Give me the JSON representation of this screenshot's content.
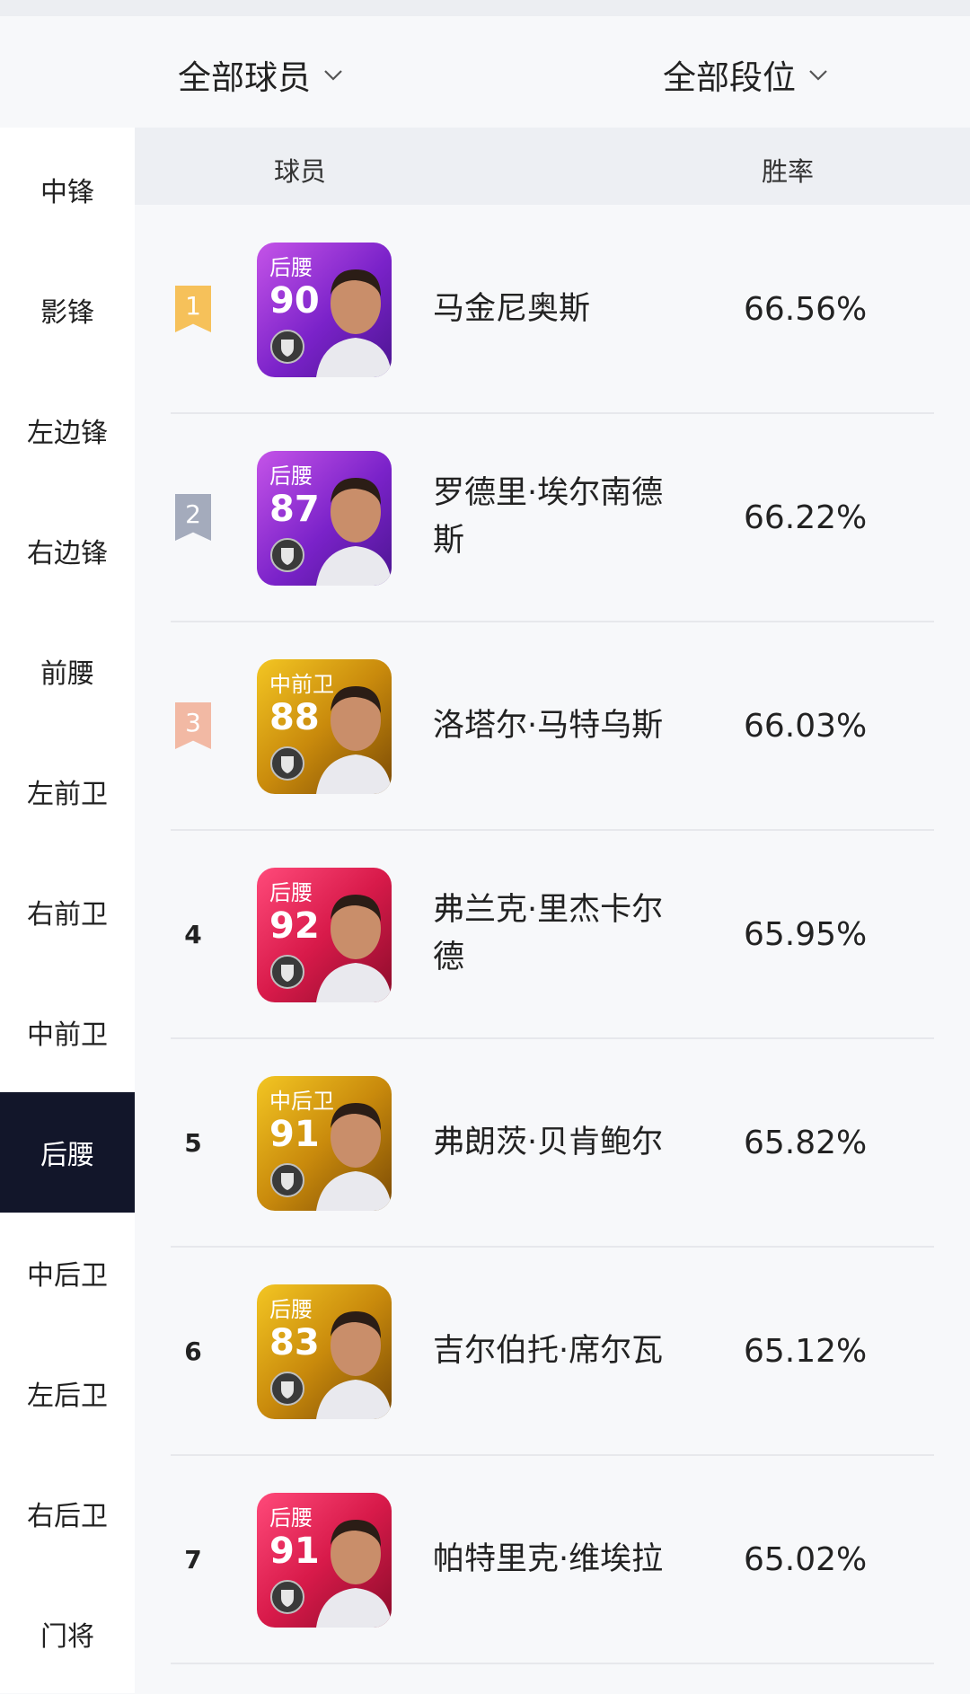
{
  "filters": {
    "player_filter": "全部球员",
    "tier_filter": "全部段位"
  },
  "sidebar": {
    "items": [
      {
        "label": "中锋"
      },
      {
        "label": "影锋"
      },
      {
        "label": "左边锋"
      },
      {
        "label": "右边锋"
      },
      {
        "label": "前腰"
      },
      {
        "label": "左前卫"
      },
      {
        "label": "右前卫"
      },
      {
        "label": "中前卫"
      },
      {
        "label": "后腰",
        "active": true
      },
      {
        "label": "中后卫"
      },
      {
        "label": "左后卫"
      },
      {
        "label": "右后卫"
      },
      {
        "label": "门将"
      }
    ]
  },
  "table": {
    "headers": {
      "player": "球员",
      "win_rate": "胜率"
    },
    "rows": [
      {
        "rank": "1",
        "position": "后腰",
        "rating": "90",
        "name": "马金尼奥斯",
        "win_rate": "66.56%",
        "card_color": "purple",
        "rank_color": "#f6c15a"
      },
      {
        "rank": "2",
        "position": "后腰",
        "rating": "87",
        "name": "罗德里·埃尔南德斯",
        "win_rate": "66.22%",
        "card_color": "purple",
        "rank_color": "#a4abbc"
      },
      {
        "rank": "3",
        "position": "中前卫",
        "rating": "88",
        "name": "洛塔尔·马特乌斯",
        "win_rate": "66.03%",
        "card_color": "gold",
        "rank_color": "#f2b9a4"
      },
      {
        "rank": "4",
        "position": "后腰",
        "rating": "92",
        "name": "弗兰克·里杰卡尔德",
        "win_rate": "65.95%",
        "card_color": "red"
      },
      {
        "rank": "5",
        "position": "中后卫",
        "rating": "91",
        "name": "弗朗茨·贝肯鲍尔",
        "win_rate": "65.82%",
        "card_color": "gold"
      },
      {
        "rank": "6",
        "position": "后腰",
        "rating": "83",
        "name": "吉尔伯托·席尔瓦",
        "win_rate": "65.12%",
        "card_color": "gold"
      },
      {
        "rank": "7",
        "position": "后腰",
        "rating": "91",
        "name": "帕特里克·维埃拉",
        "win_rate": "65.02%",
        "card_color": "red"
      }
    ]
  }
}
